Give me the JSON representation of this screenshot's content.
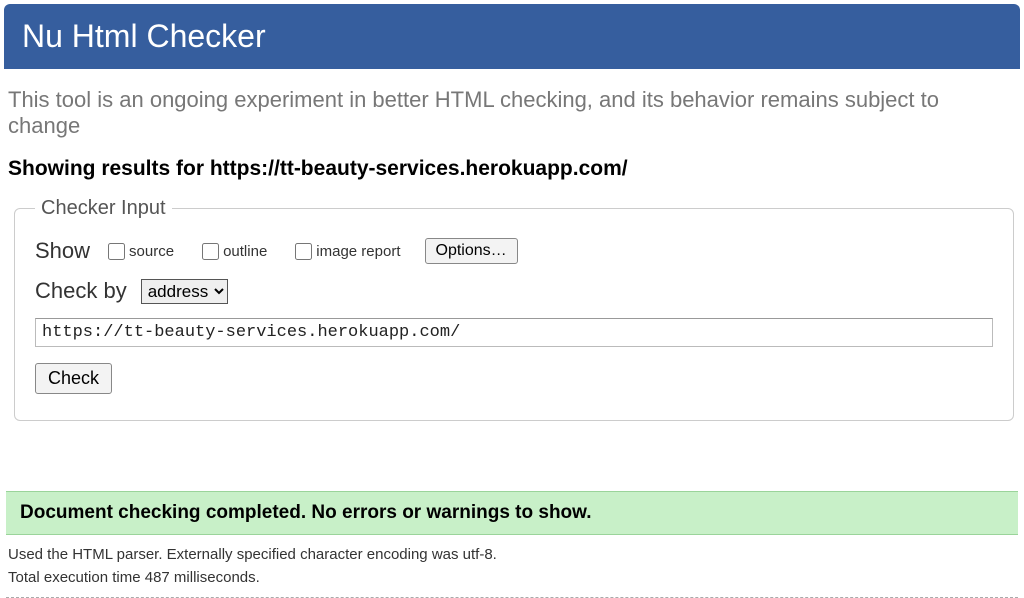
{
  "header": {
    "title": "Nu Html Checker"
  },
  "intro": "This tool is an ongoing experiment in better HTML checking, and its behavior remains subject to change",
  "results_heading": "Showing results for https://tt-beauty-services.herokuapp.com/",
  "checker": {
    "legend": "Checker Input",
    "show_label": "Show",
    "checkboxes": {
      "source": "source",
      "outline": "outline",
      "image_report": "image report"
    },
    "options_button": "Options…",
    "check_by_label": "Check by",
    "check_by_value": "address",
    "url_value": "https://tt-beauty-services.herokuapp.com/",
    "check_button": "Check"
  },
  "status": "Document checking completed. No errors or warnings to show.",
  "footer": {
    "parser": "Used the HTML parser. Externally specified character encoding was utf-8.",
    "time": "Total execution time 487 milliseconds."
  }
}
